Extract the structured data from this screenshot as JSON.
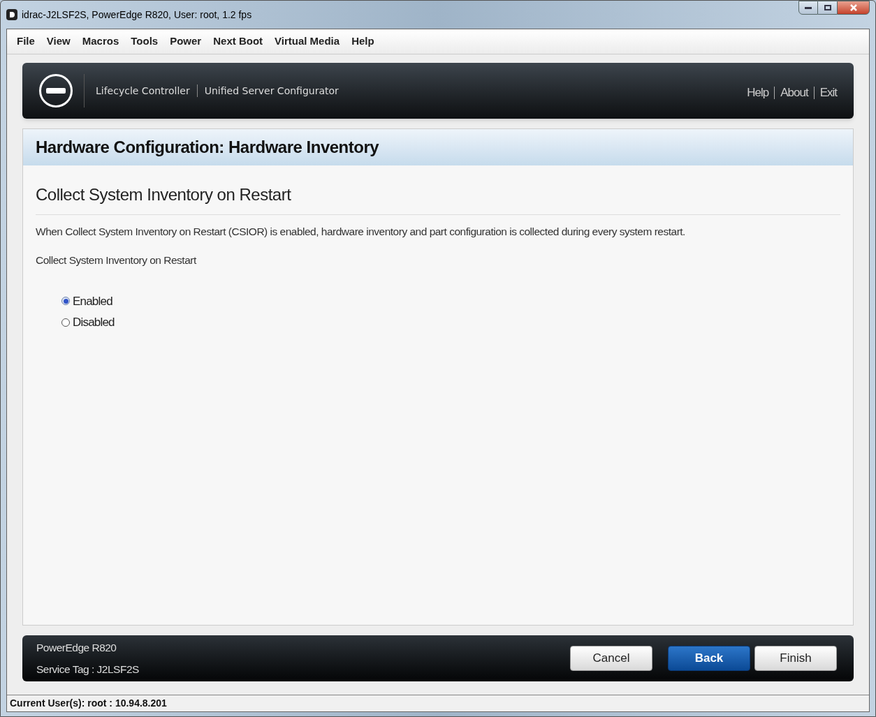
{
  "window": {
    "title": "idrac-J2LSF2S, PowerEdge R820, User: root, 1.2 fps"
  },
  "menu": [
    "File",
    "View",
    "Macros",
    "Tools",
    "Power",
    "Next Boot",
    "Virtual Media",
    "Help"
  ],
  "header": {
    "product": "Lifecycle Controller",
    "subtitle": "Unified Server Configurator",
    "links": [
      "Help",
      "About",
      "Exit"
    ]
  },
  "page": {
    "title": "Hardware Configuration: Hardware Inventory",
    "section": "Collect System Inventory on Restart",
    "description": "When Collect System Inventory on Restart (CSIOR) is enabled, hardware inventory and part configuration is collected during every system restart.",
    "field_label": "Collect System Inventory on Restart",
    "options": [
      {
        "label": "Enabled",
        "selected": true
      },
      {
        "label": "Disabled",
        "selected": false
      }
    ]
  },
  "footer": {
    "model": "PowerEdge R820",
    "service_tag": "Service Tag : J2LSF2S",
    "buttons": [
      {
        "label": "Cancel",
        "kind": "default"
      },
      {
        "label": "Back",
        "kind": "primary"
      },
      {
        "label": "Finish",
        "kind": "default"
      }
    ]
  },
  "status_bar": "Current User(s): root : 10.94.8.201"
}
